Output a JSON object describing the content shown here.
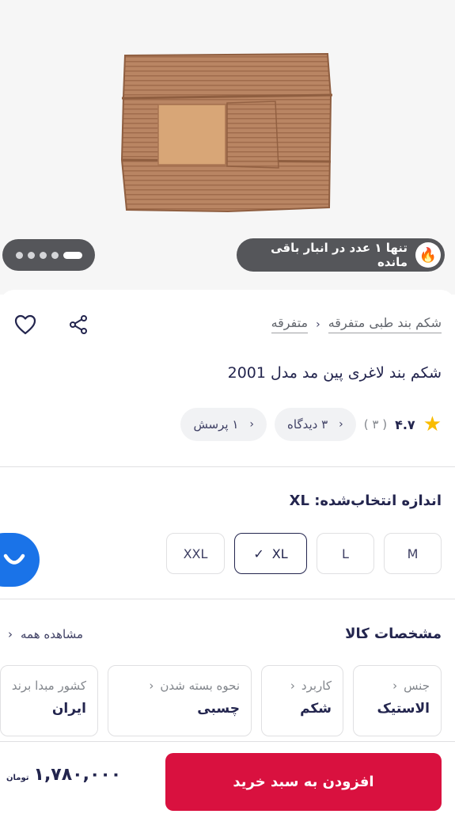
{
  "hero": {
    "stock_notice": "تنها ۱ عدد در انبار باقی مانده",
    "fire_icon": "🔥",
    "gallery_pages": 5,
    "gallery_active_page": 1
  },
  "breadcrumb": {
    "items": [
      "متفرقه",
      "شکم بند طبی متفرقه"
    ],
    "separator": "‹"
  },
  "product": {
    "title": "شکم بند لاغری پین مد مدل 2001",
    "rating": "۴.۷",
    "rating_count": "( ۳ )",
    "star_icon": "★",
    "views_chip": "۳ دیدگاه",
    "questions_chip": "۱ پرسش",
    "chip_arrow": "‹"
  },
  "size": {
    "label": "اندازه انتخاب‌شده: XL",
    "options": [
      "M",
      "L",
      "XL",
      "XXL"
    ],
    "selected": "XL",
    "check": "✓"
  },
  "specs": {
    "title": "مشخصات کالا",
    "see_all": "مشاهده همه",
    "see_all_arrow": "‹",
    "items": [
      {
        "key": "جنس",
        "value": "الاستیک"
      },
      {
        "key": "کاربرد",
        "value": "شکم"
      },
      {
        "key": "نحوه بسته شدن",
        "value": "چسبی"
      },
      {
        "key": "کشور مبدا برند",
        "value": "ایران"
      }
    ],
    "item_arrow": "‹"
  },
  "buy": {
    "add_to_cart": "افزودن به سبد خرید",
    "price": "۱,۷۸۰,۰۰۰",
    "currency": "تومان"
  },
  "colors": {
    "primary_red": "#d9113f",
    "dark_text": "#23254e",
    "star": "#f9bc00",
    "chat_blue": "#1a73e8"
  }
}
